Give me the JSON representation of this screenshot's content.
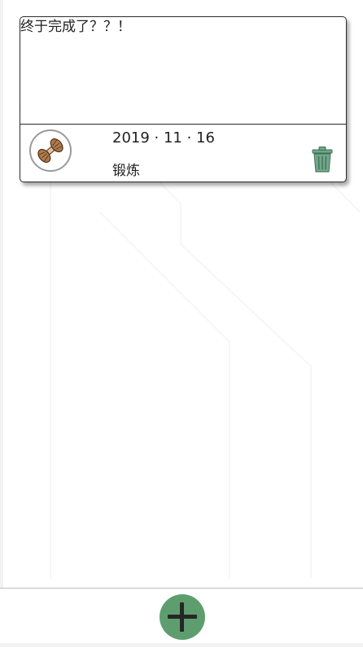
{
  "entry": {
    "content": "终于完成了？？！",
    "date": "2019 · 11 · 16",
    "category": "锻炼",
    "avatar_icon": "dumbbell-icon",
    "delete_icon": "trash-icon"
  },
  "footer": {
    "add_icon": "plus-icon"
  },
  "colors": {
    "accent": "#5e9e6e",
    "trash": "#6fa88a",
    "border": "#2b2b2b"
  }
}
